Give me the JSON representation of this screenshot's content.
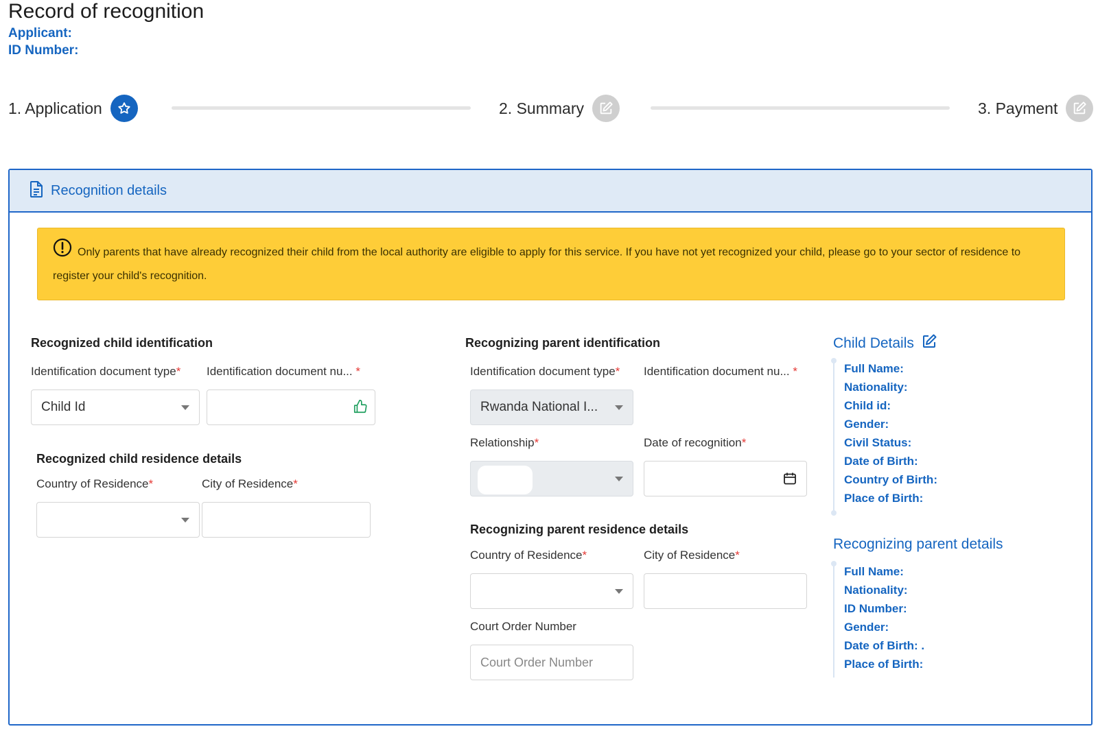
{
  "page": {
    "title": "Record of recognition",
    "applicant_label": "Applicant:",
    "id_number_label": "ID Number:"
  },
  "stepper": {
    "steps": [
      {
        "label": "1. Application",
        "icon": "star-icon",
        "state": "active"
      },
      {
        "label": "2. Summary",
        "icon": "edit-icon",
        "state": "inactive"
      },
      {
        "label": "3. Payment",
        "icon": "edit-icon",
        "state": "inactive"
      }
    ]
  },
  "card": {
    "title": "Recognition details",
    "icon": "document-icon",
    "alert": "Only parents that have already recognized their child from the local authority are eligible to apply for this service. If you have not yet recognized your child, please go to your sector of residence to register your child's recognition."
  },
  "child_identification": {
    "title": "Recognized child identification",
    "doc_type_label": "Identification document type",
    "doc_type_value": "Child Id",
    "doc_number_label": "Identification document nu...",
    "doc_number_value": ""
  },
  "child_residence": {
    "title": "Recognized child residence details",
    "country_label": "Country of Residence",
    "country_value": "",
    "city_label": "City of Residence",
    "city_value": ""
  },
  "parent_identification": {
    "title": "Recognizing parent identification",
    "doc_type_label": "Identification document type",
    "doc_type_value": "Rwanda National I...",
    "doc_number_label": "Identification document nu...",
    "doc_number_value": "",
    "relationship_label": "Relationship",
    "relationship_value": "",
    "date_label": "Date of recognition",
    "date_value": ""
  },
  "parent_residence": {
    "title": "Recognizing parent residence details",
    "country_label": "Country of Residence",
    "country_value": "",
    "city_label": "City of Residence",
    "city_value": "",
    "court_order_label": "Court Order Number",
    "court_order_placeholder": "Court Order Number"
  },
  "child_details": {
    "title": "Child Details",
    "items": [
      "Full Name:",
      "Nationality:",
      "Child id:",
      "Gender:",
      "Civil Status:",
      "Date of Birth:",
      "Country of Birth:",
      "Place of Birth:"
    ]
  },
  "parent_details": {
    "title": "Recognizing parent details",
    "items": [
      "Full Name:",
      "Nationality:",
      "ID Number:",
      "Gender:",
      "Date of Birth: .",
      "Place of Birth:"
    ]
  },
  "colors": {
    "primary": "#1565c0",
    "alert_bg": "#fecd38",
    "required": "#e53935",
    "header_bg": "#dfeaf6"
  }
}
